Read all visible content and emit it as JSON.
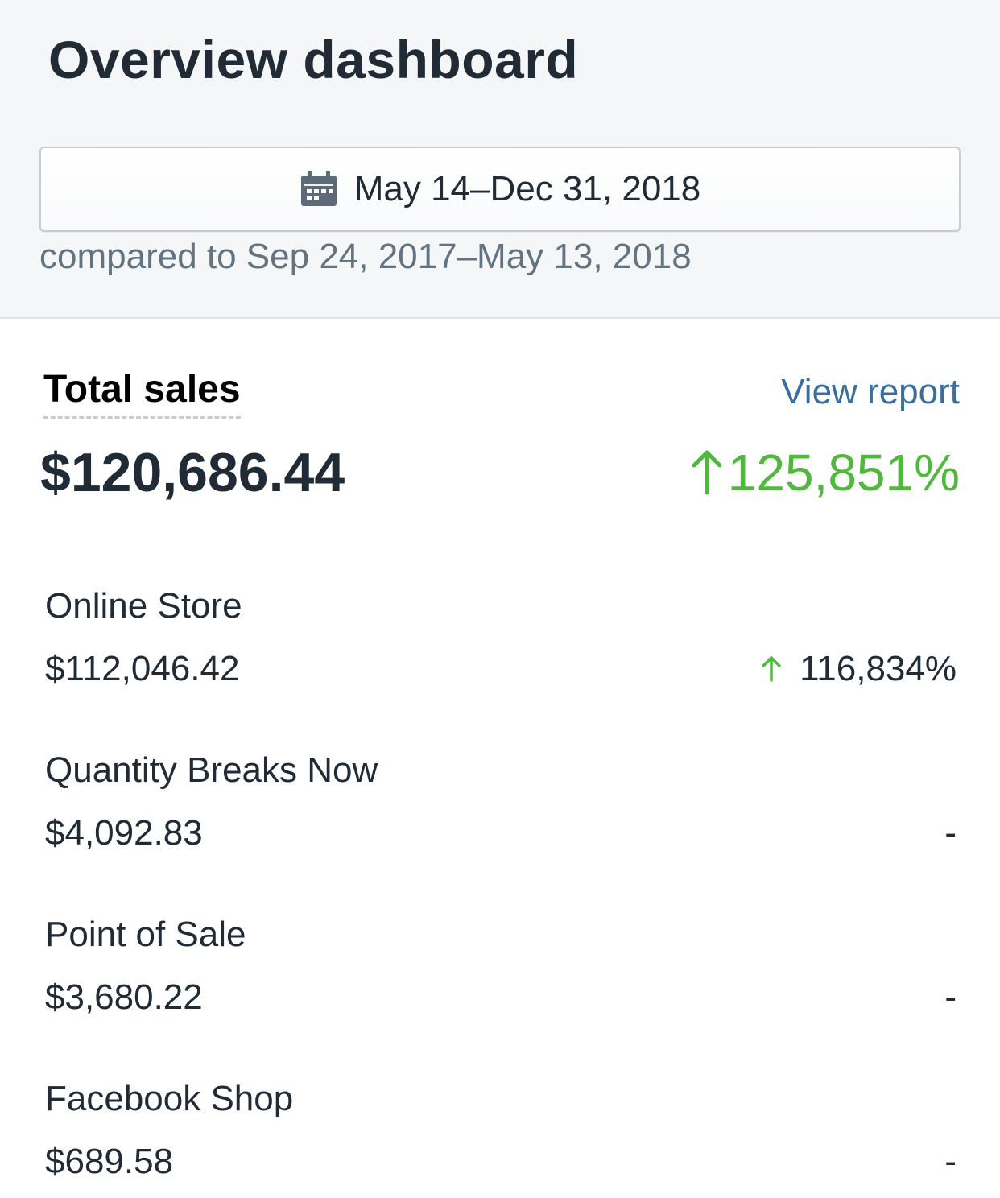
{
  "header": {
    "title": "Overview dashboard",
    "date_range": "May 14–Dec 31, 2018",
    "comparison": "compared to Sep 24, 2017–May 13, 2018"
  },
  "total_sales": {
    "label": "Total sales",
    "view_report": "View report",
    "value": "$120,686.44",
    "change": "125,851%",
    "change_color": "#50b83c",
    "change_icon": "arrow-up-icon"
  },
  "channels": [
    {
      "name": "Online Store",
      "value": "$112,046.42",
      "change": "116,834%",
      "trend": "up"
    },
    {
      "name": "Quantity Breaks Now",
      "value": "$4,092.83",
      "change": "-",
      "trend": "none"
    },
    {
      "name": "Point of Sale",
      "value": "$3,680.22",
      "change": "-",
      "trend": "none"
    },
    {
      "name": "Facebook Shop",
      "value": "$689.58",
      "change": "-",
      "trend": "none"
    }
  ],
  "colors": {
    "header_bg": "#f4f6f8",
    "text_primary": "#212b36",
    "text_subdued": "#637381",
    "link": "#3a6e9e",
    "positive": "#50b83c"
  }
}
